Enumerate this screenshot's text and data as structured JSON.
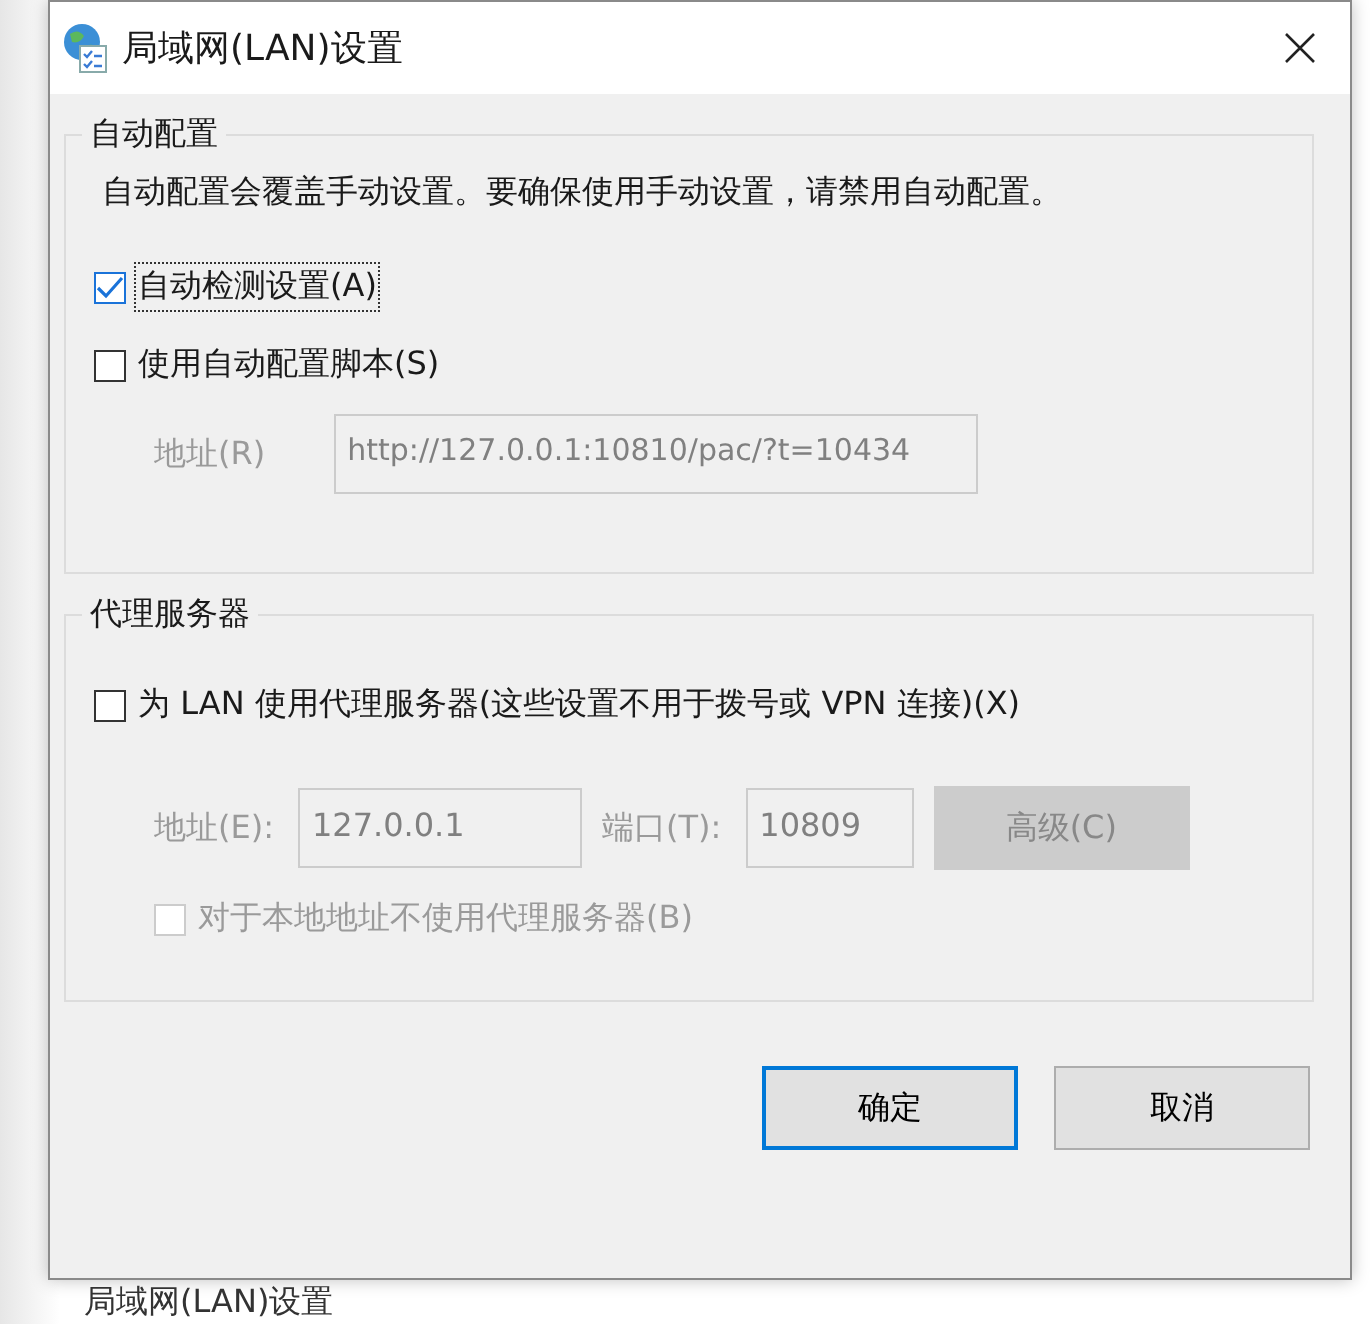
{
  "window": {
    "title": "局域网(LAN)设置"
  },
  "auto_config": {
    "title": "自动配置",
    "description": "自动配置会覆盖手动设置。要确保使用手动设置，请禁用自动配置。",
    "options": [
      {
        "label": "自动检测设置(A)",
        "checked": true,
        "focused": true
      },
      {
        "label": "使用自动配置脚本(S)",
        "checked": false,
        "focused": false
      }
    ],
    "script_address": {
      "label": "地址(R)",
      "value": "http://127.0.0.1:10810/pac/?t=10434",
      "disabled": true
    }
  },
  "proxy": {
    "title": "代理服务器",
    "use_proxy": {
      "label": "为 LAN 使用代理服务器(这些设置不用于拨号或 VPN 连接)(X)",
      "checked": false
    },
    "address": {
      "label": "地址(E):",
      "value": "127.0.0.1",
      "disabled": true
    },
    "port": {
      "label": "端口(T):",
      "value": "10809",
      "disabled": true
    },
    "advanced_button": {
      "label": "高级(C)",
      "disabled": true
    },
    "bypass_local": {
      "label": "对于本地地址不使用代理服务器(B)",
      "checked": false,
      "disabled": true
    }
  },
  "buttons": [
    {
      "label": "确定",
      "default": true
    },
    {
      "label": "取消",
      "default": false
    }
  ],
  "background_text": "局域网(LAN)设置"
}
